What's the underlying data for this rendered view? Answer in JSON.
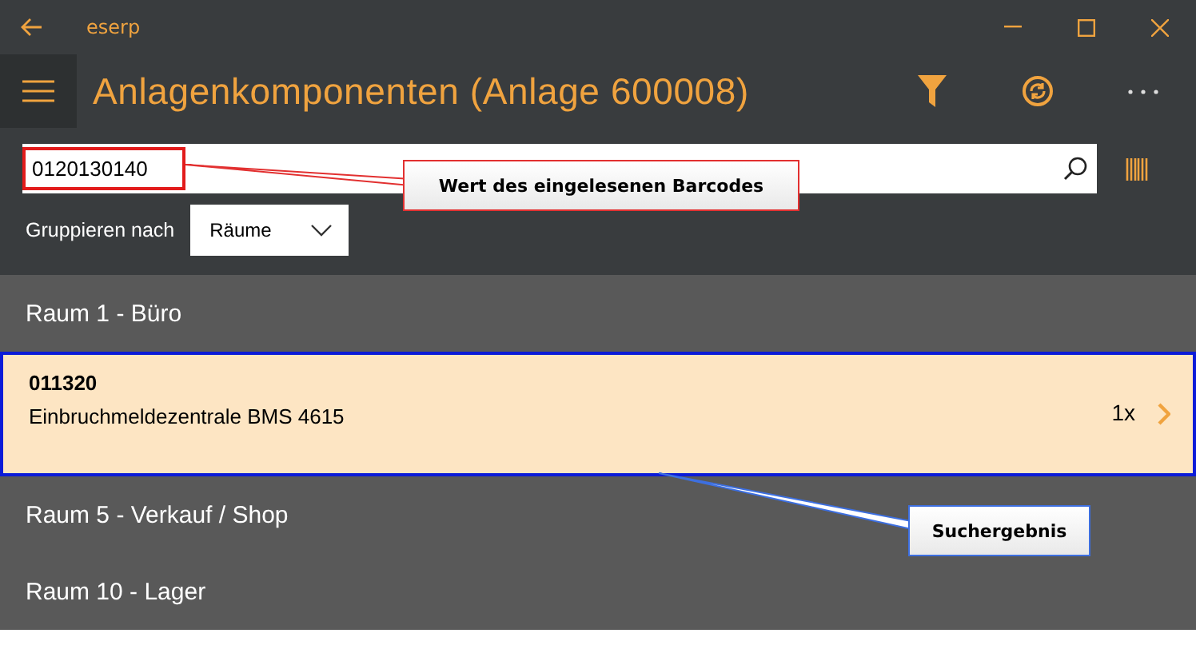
{
  "window": {
    "title": "eserp"
  },
  "header": {
    "title": "Anlagenkomponenten (Anlage 600008)"
  },
  "search": {
    "value": "0120130140"
  },
  "grouping": {
    "label": "Gruppieren nach",
    "value": "Räume"
  },
  "groups": [
    {
      "name": "Raum 1 - Büro",
      "items": [
        {
          "number": "011320",
          "description": "Einbruchmeldezentrale BMS 4615",
          "quantity": "1x",
          "selected": true
        }
      ]
    },
    {
      "name": "Raum 5 - Verkauf / Shop"
    },
    {
      "name": "Raum 10 - Lager"
    }
  ],
  "annotations": [
    {
      "text": "Wert des eingelesenen Barcodes"
    },
    {
      "text": "Suchergebnis"
    }
  ]
}
